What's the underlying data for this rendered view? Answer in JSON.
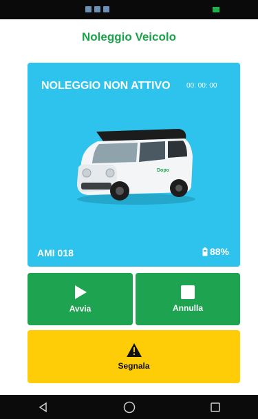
{
  "app": {
    "title": "Noleggio Veicolo"
  },
  "card": {
    "status": "NOLEGGIO NON ATTIVO",
    "timer": "00: 00: 00",
    "vehicle_id": "AMI 018",
    "battery": "88%",
    "car_brand_mark": "Dopo",
    "background_color": "#2ec3ec"
  },
  "actions": {
    "start": {
      "label": "Avvia",
      "icon": "play-icon",
      "color": "#1ea350"
    },
    "cancel": {
      "label": "Annulla",
      "icon": "stop-icon",
      "color": "#1ea350"
    },
    "report": {
      "label": "Segnala",
      "icon": "warning-icon",
      "color": "#ffcd07"
    }
  },
  "nav": {
    "back": "back-icon",
    "home": "home-icon",
    "recents": "recents-icon"
  }
}
